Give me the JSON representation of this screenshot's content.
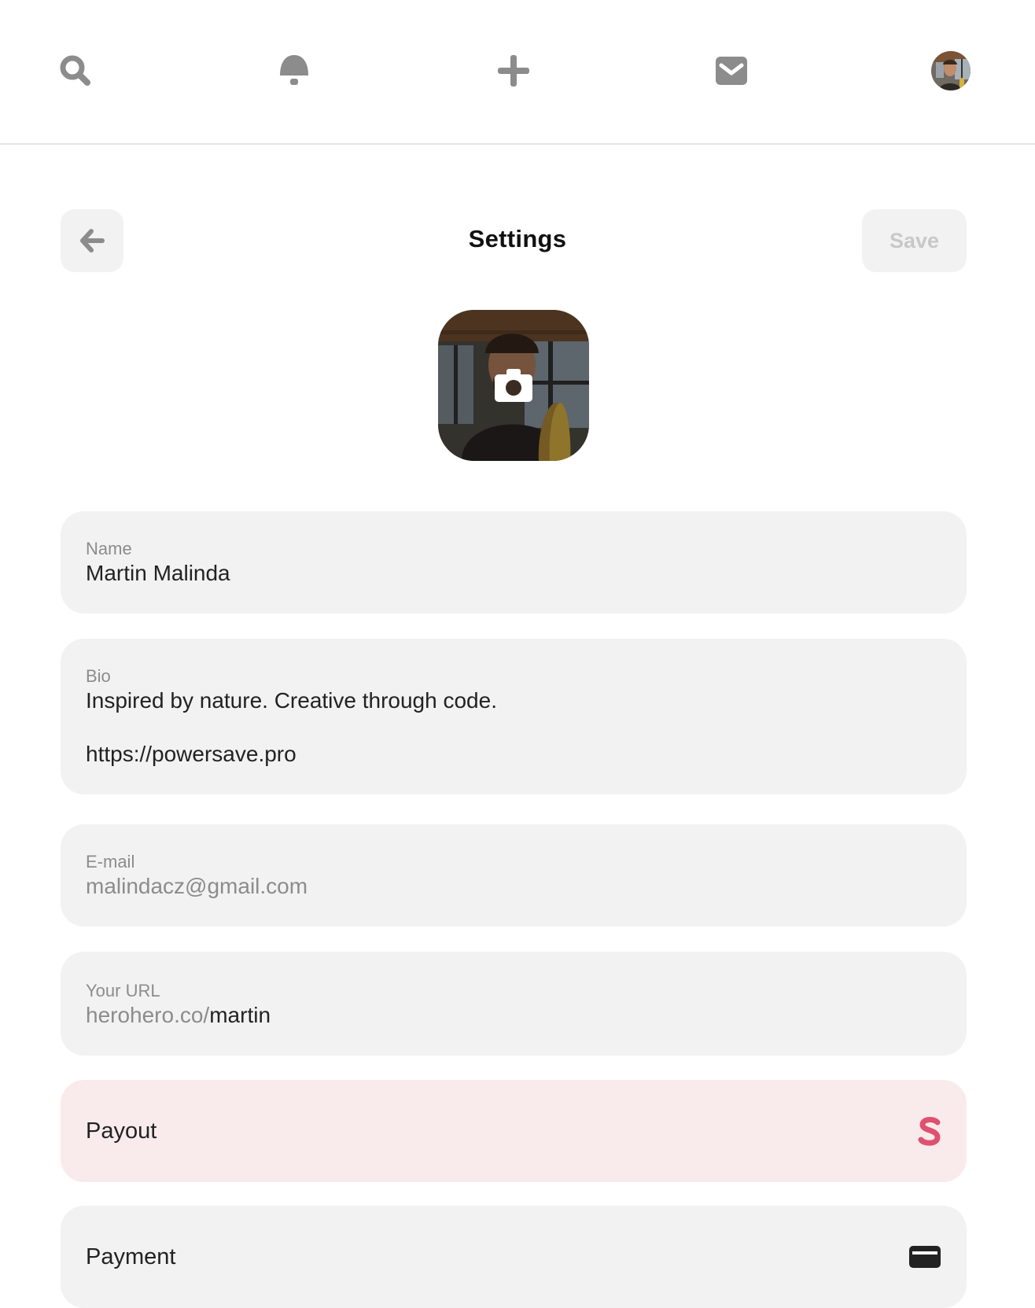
{
  "nav": {
    "items": [
      {
        "name": "search",
        "icon": "search-icon"
      },
      {
        "name": "notifications",
        "icon": "bell-icon"
      },
      {
        "name": "create",
        "icon": "plus-icon"
      },
      {
        "name": "messages",
        "icon": "envelope-icon"
      },
      {
        "name": "profile",
        "icon": "avatar"
      }
    ]
  },
  "header": {
    "title": "Settings",
    "back_icon": "arrow-left-icon",
    "save_label": "Save"
  },
  "profile_photo": {
    "overlay_icon": "camera-icon"
  },
  "fields": {
    "name": {
      "label": "Name",
      "value": "Martin Malinda"
    },
    "bio": {
      "label": "Bio",
      "lines": [
        "Inspired by nature. Creative through code.",
        "",
        "https://powersave.pro"
      ]
    },
    "email": {
      "label": "E-mail",
      "value": "malindacz@gmail.com"
    },
    "url": {
      "label": "Your URL",
      "prefix": "herohero.co/",
      "value": "martin"
    }
  },
  "rows": {
    "payout": {
      "label": "Payout",
      "icon": "stripe-s-icon"
    },
    "payment": {
      "label": "Payment",
      "icon": "credit-card-icon"
    }
  },
  "colors": {
    "icon_gray": "#8c8c8c",
    "field_bg": "#f2f2f2",
    "payout_bg": "#f9ebec",
    "stripe_pink": "#e05070"
  }
}
